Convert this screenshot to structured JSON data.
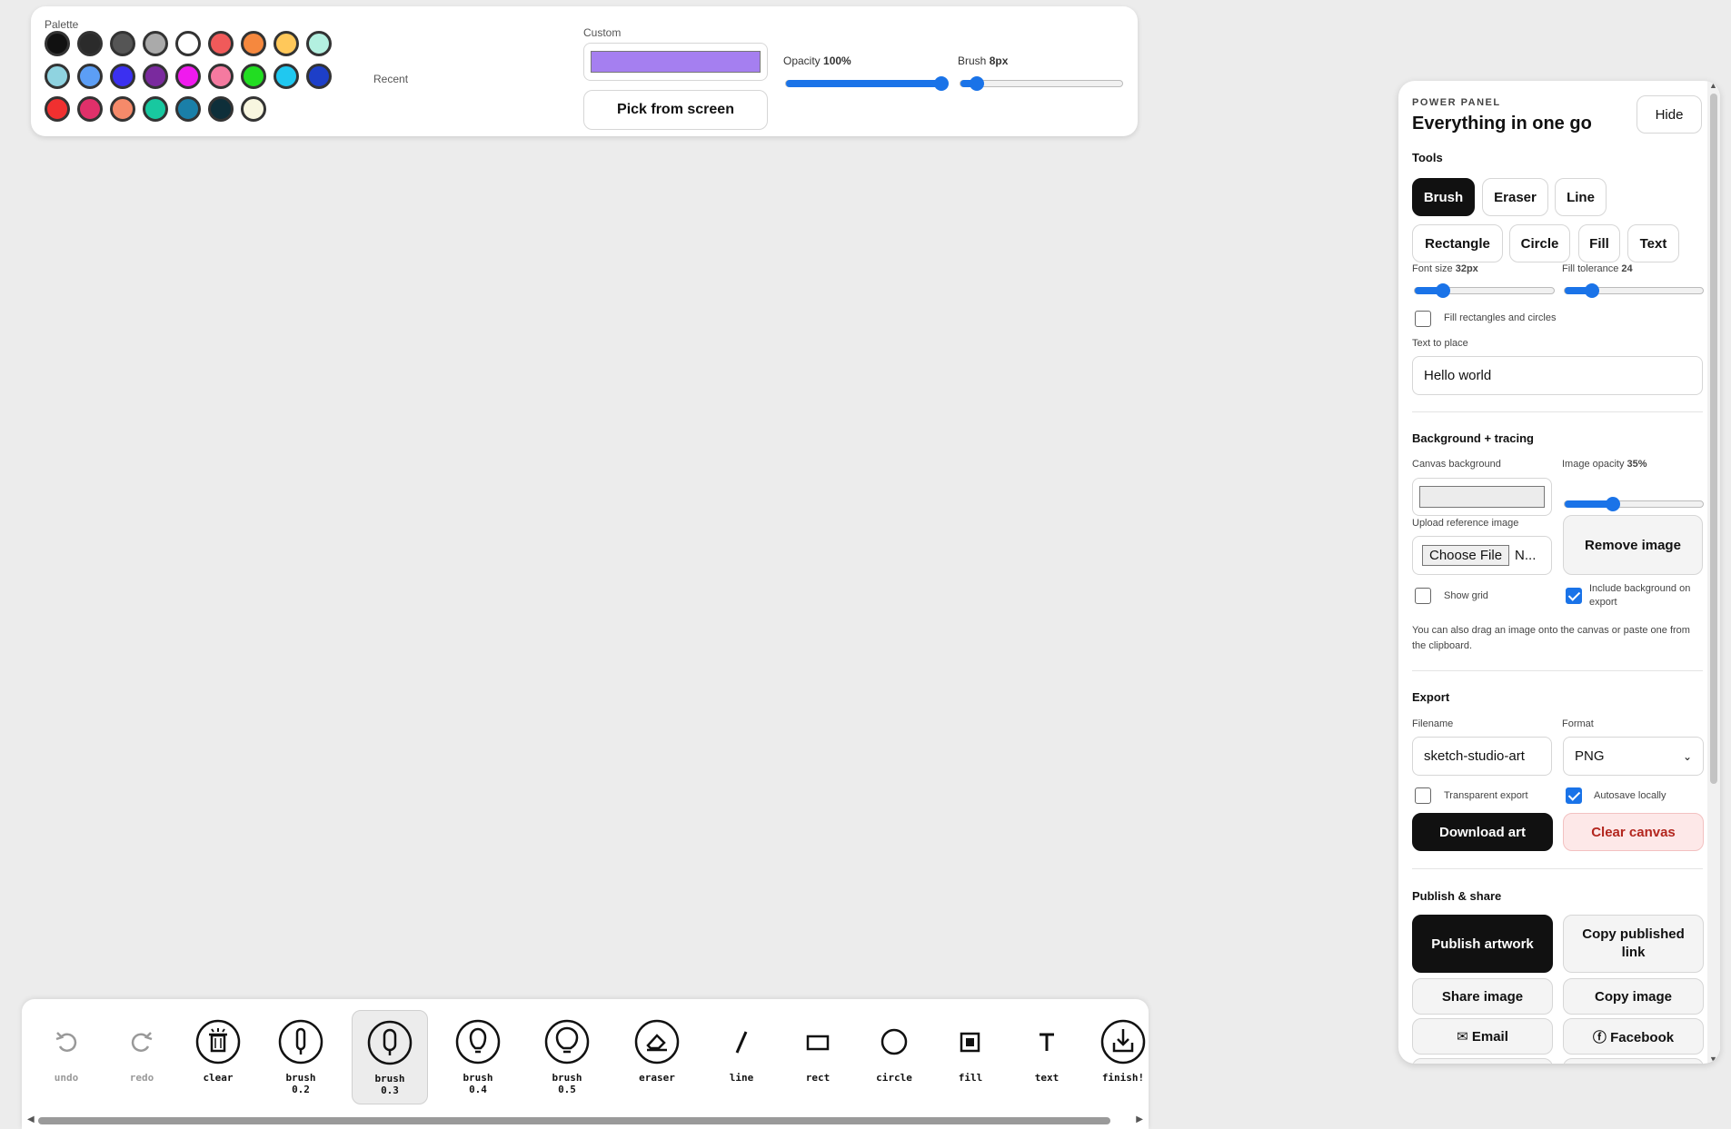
{
  "palette": {
    "label": "Palette",
    "rows": [
      [
        "#111111",
        "#2b2b2b",
        "#555555",
        "#aaaaaa",
        "#ffffff",
        "#f05a5a",
        "#f5883e",
        "#ffc85a",
        "#b3f0e0"
      ],
      [
        "#8fd3e0",
        "#5c9ef5",
        "#3b30f0",
        "#7a2a9e",
        "#f01aee",
        "#f57aa0",
        "#22dd22",
        "#20c8f0",
        "#1d3fc8"
      ],
      [
        "#f03030",
        "#e0306a",
        "#f58a6a",
        "#18c8a0",
        "#1a7fa8",
        "#0e2f3a",
        "#f8f6e0"
      ]
    ],
    "recent_label": "Recent",
    "custom_label": "Custom",
    "custom_color": "#a57ff0",
    "pick_from_screen": "Pick from screen",
    "opacity_label": "Opacity",
    "opacity_value": "100%",
    "opacity_fraction": 1.0,
    "brush_label": "Brush",
    "brush_value": "8px",
    "brush_fraction": 0.1
  },
  "panel": {
    "kicker": "POWER PANEL",
    "title": "Everything in one go",
    "hide": "Hide",
    "tools_title": "Tools",
    "tools": [
      "Brush",
      "Eraser",
      "Line",
      "Rectangle",
      "Circle",
      "Fill",
      "Text"
    ],
    "active_tool": "Brush",
    "font_size_label": "Font size",
    "font_size_value": "32px",
    "font_size_fraction": 0.2,
    "fill_tol_label": "Fill tolerance",
    "fill_tol_value": "24",
    "fill_tol_fraction": 0.2,
    "fill_shapes": "Fill rectangles and circles",
    "text_to_place_label": "Text to place",
    "text_to_place_value": "Hello world",
    "bg_title": "Background + tracing",
    "canvas_bg_label": "Canvas background",
    "canvas_bg_color": "#ececec",
    "image_opacity_label": "Image opacity",
    "image_opacity_value": "35%",
    "image_opacity_fraction": 0.35,
    "upload_label": "Upload reference image",
    "choose_file": "Choose File",
    "file_status": "N...",
    "remove_image": "Remove image",
    "show_grid": "Show grid",
    "include_bg": "Include background on export",
    "drag_hint": "You can also drag an image onto the canvas or paste one from the clipboard.",
    "export_title": "Export",
    "filename_label": "Filename",
    "filename_value": "sketch-studio-art",
    "format_label": "Format",
    "format_value": "PNG",
    "transparent_export": "Transparent export",
    "autosave": "Autosave locally",
    "download": "Download art",
    "clear_canvas": "Clear canvas",
    "publish_title": "Publish & share",
    "publish": "Publish artwork",
    "copy_link": "Copy published link",
    "share_image": "Share image",
    "copy_image": "Copy image",
    "email": "✉ Email",
    "facebook": "ⓕ Facebook"
  },
  "toolbar": {
    "undo": "undo",
    "redo": "redo",
    "clear": "clear",
    "brush02": "brush\n0.2",
    "brush03": "brush\n0.3",
    "brush04": "brush\n0.4",
    "brush05": "brush\n0.5",
    "eraser": "eraser",
    "line": "line",
    "rect": "rect",
    "circle": "circle",
    "fill": "fill",
    "text": "text",
    "finish": "finish!"
  }
}
